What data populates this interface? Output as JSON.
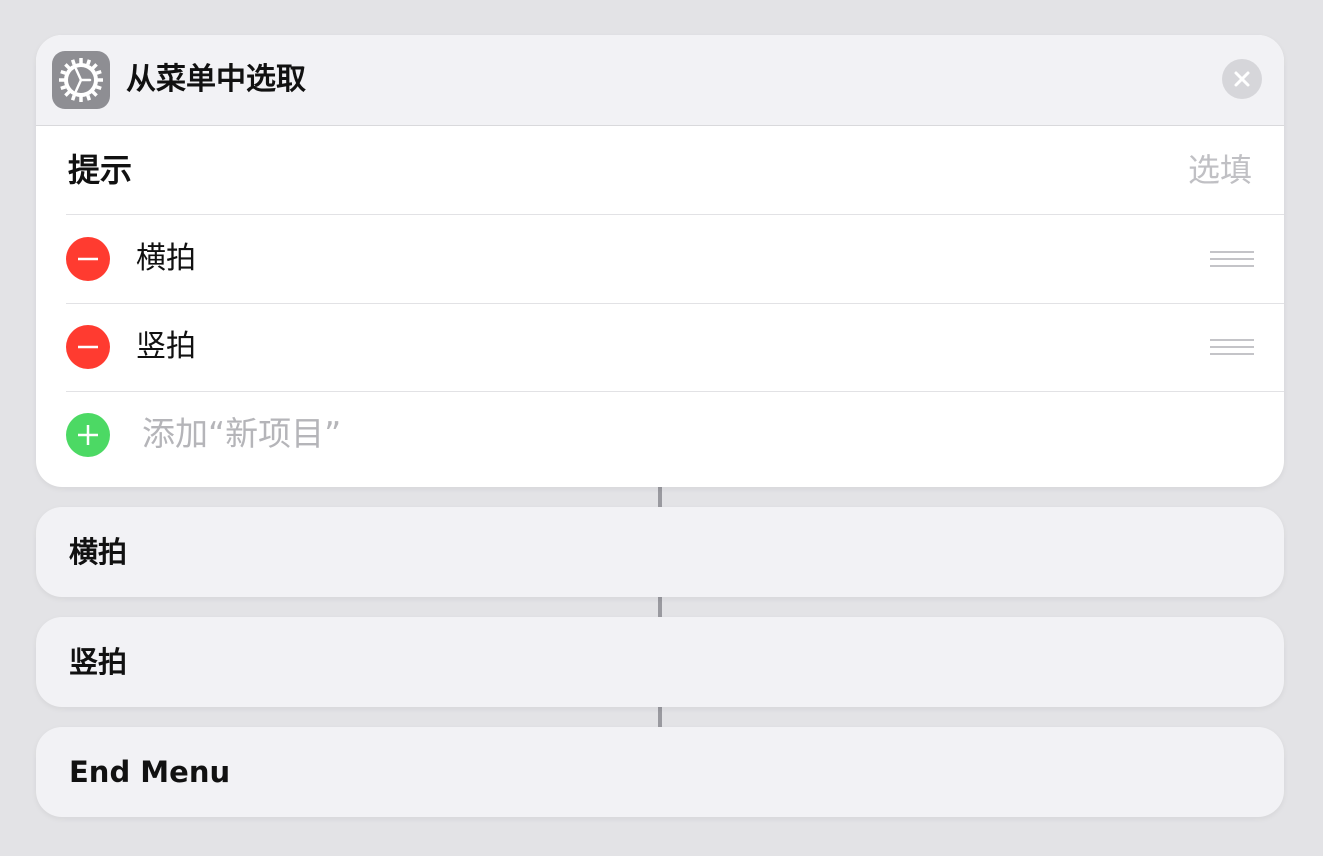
{
  "action": {
    "title": "从菜单中选取",
    "icon": "gear-icon",
    "close_icon": "close-icon"
  },
  "prompt": {
    "label": "提示",
    "placeholder": "选填"
  },
  "menu_items": [
    {
      "label": "横拍"
    },
    {
      "label": "竖拍"
    }
  ],
  "add_item": {
    "label": "添加“新项目”"
  },
  "blocks": [
    {
      "label": "横拍"
    },
    {
      "label": "竖拍"
    },
    {
      "label": "End Menu"
    }
  ],
  "colors": {
    "remove": "#ff3b30",
    "add": "#4cd964",
    "icon_bg": "#8e8e93"
  }
}
